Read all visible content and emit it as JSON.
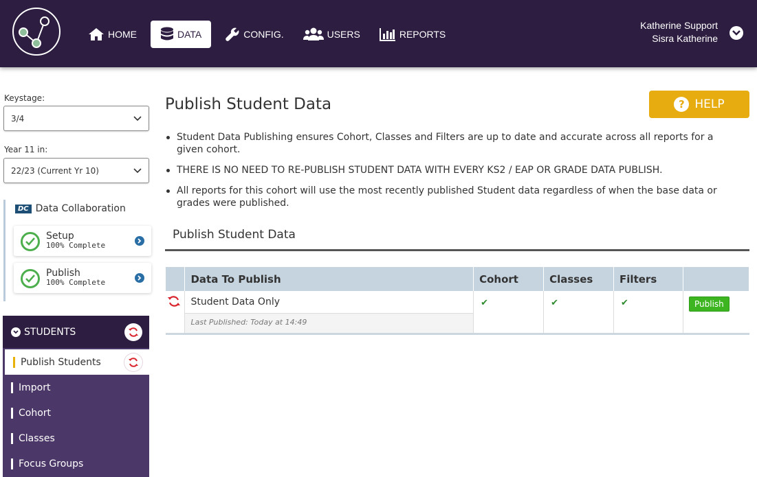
{
  "nav": {
    "items": [
      {
        "label": "HOME",
        "icon": "home-icon"
      },
      {
        "label": "DATA",
        "icon": "database-icon"
      },
      {
        "label": "CONFIG.",
        "icon": "wrench-icon"
      },
      {
        "label": "USERS",
        "icon": "users-icon"
      },
      {
        "label": "REPORTS",
        "icon": "bar-chart-icon"
      }
    ],
    "active": "DATA"
  },
  "user": {
    "line1": "Katherine Support",
    "line2": "Sisra Katherine"
  },
  "sidebar": {
    "keystage_label": "Keystage:",
    "keystage_value": "3/4",
    "year_label": "Year 11 in:",
    "year_value": "22/23 (Current Yr 10)",
    "dc_badge": "DC",
    "dc_title": "Data Collaboration",
    "steps": [
      {
        "name": "Setup",
        "status": "100% Complete"
      },
      {
        "name": "Publish",
        "status": "100% Complete"
      }
    ],
    "students_header": "STUDENTS",
    "menu": [
      "Publish Students",
      "Import",
      "Cohort",
      "Classes",
      "Focus Groups"
    ]
  },
  "main": {
    "title": "Publish Student Data",
    "help_label": "HELP",
    "bullets": [
      "Student Data Publishing ensures Cohort, Classes and Filters are up to date and accurate across all reports for a given cohort.",
      "THERE IS NO NEED TO RE-PUBLISH STUDENT DATA WITH EVERY KS2 / EAP OR GRADE DATA PUBLISH.",
      "All reports for this cohort will use the most recently published Student data regardless of when the base data or grades were published."
    ],
    "section_title": "Publish Student Data",
    "table": {
      "headers": [
        "Data To Publish",
        "Cohort",
        "Classes",
        "Filters"
      ],
      "row": {
        "name": "Student Data Only",
        "last_published": "Last Published: Today at 14:49",
        "cohort": "✔",
        "classes": "✔",
        "filters": "✔",
        "action": "Publish"
      }
    }
  },
  "colors": {
    "topbar": "#2d1d40",
    "help": "#e6ac10",
    "publish": "#3cb521",
    "accent_bar": "#e7b10a"
  }
}
